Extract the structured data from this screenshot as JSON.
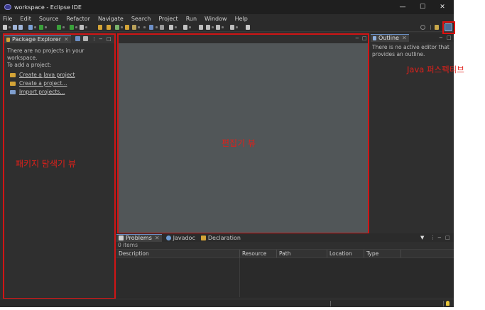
{
  "window": {
    "title": "workspace - Eclipse IDE"
  },
  "window_controls": {
    "minimize": "—",
    "maximize": "☐",
    "close": "✕"
  },
  "menu": [
    "File",
    "Edit",
    "Source",
    "Refactor",
    "Navigate",
    "Search",
    "Project",
    "Run",
    "Window",
    "Help"
  ],
  "package_explorer": {
    "tab_label": "Package Explorer",
    "message_line1": "There are no projects in your workspace.",
    "message_line2": "To add a project:",
    "links": [
      "Create a Java project",
      "Create a project...",
      "Import projects..."
    ]
  },
  "outline": {
    "tab_label": "Outline",
    "message_line1": "There is no active editor that",
    "message_line2": "provides an outline."
  },
  "bottom_panel": {
    "tabs": [
      "Problems",
      "Javadoc",
      "Declaration"
    ],
    "items_count": "0 items",
    "columns": [
      "Description",
      "Resource",
      "Path",
      "Location",
      "Type"
    ]
  },
  "annotations": {
    "package_explorer": "패키지 탐색기 뷰",
    "editor": "편집기 뷰",
    "perspective": "Java 퍼스펙티브"
  },
  "colors": {
    "annotation_red": "#d01515",
    "editor_bg": "#515658",
    "ide_bg": "#2f2f2f"
  }
}
